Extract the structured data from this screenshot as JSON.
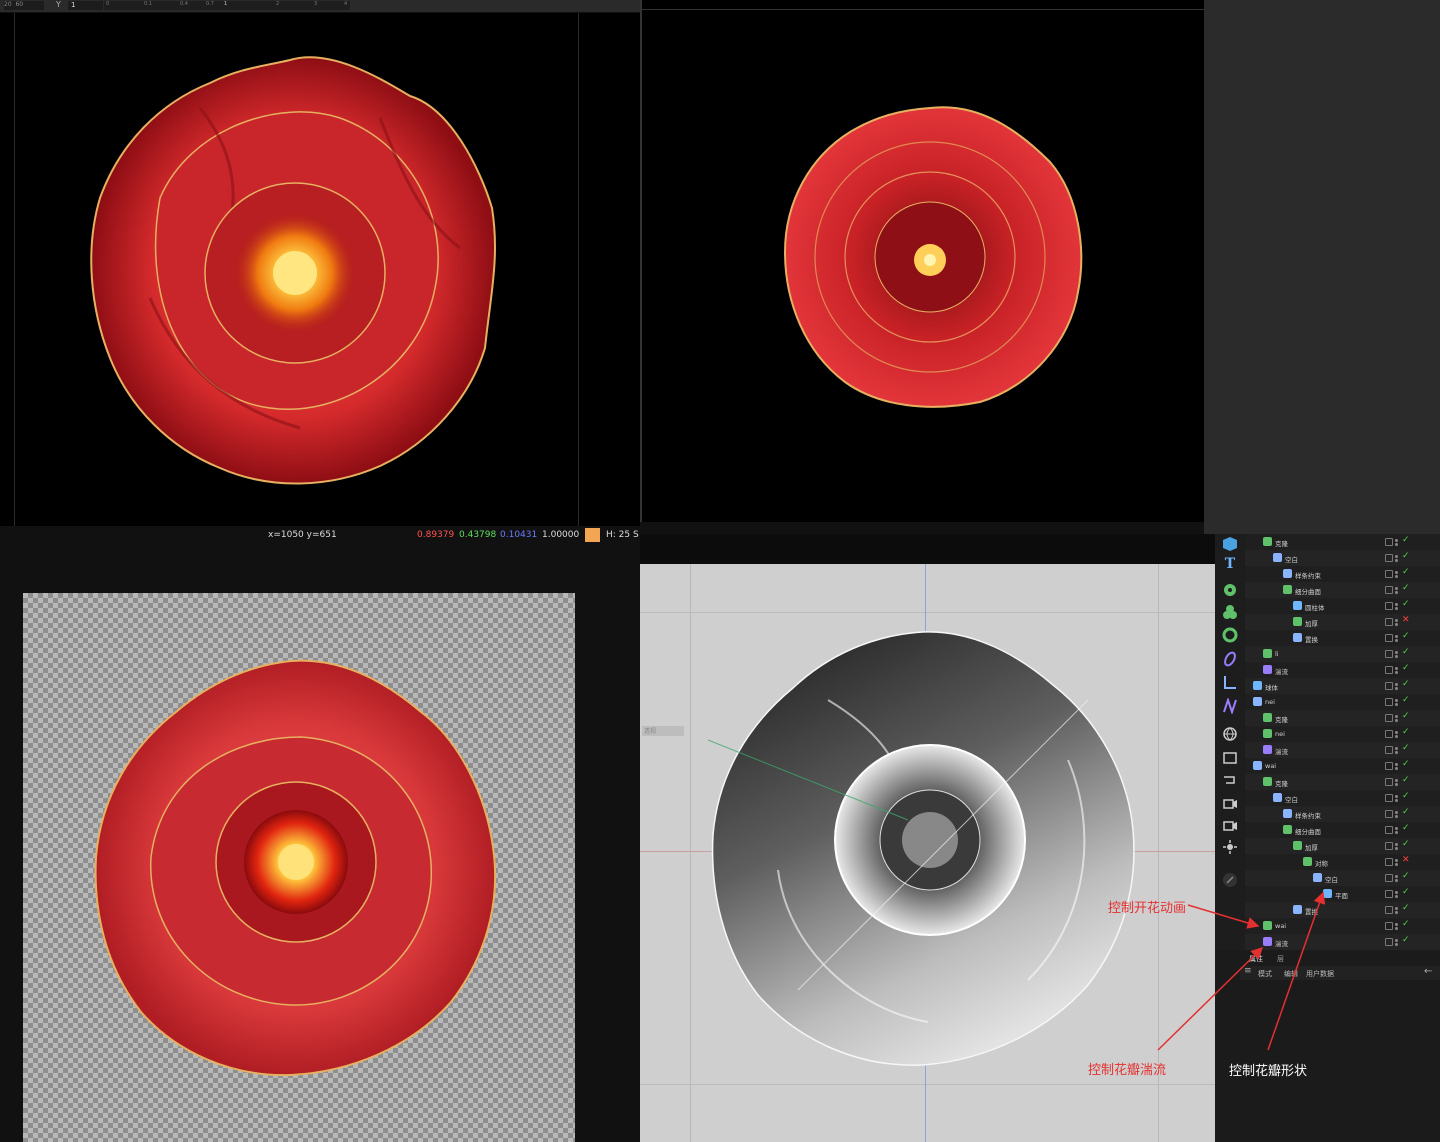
{
  "topbar": {
    "y_label": "Y",
    "y_value": "1",
    "ruler_ticks": [
      "0",
      "0.1",
      "0.4",
      "0.7",
      "1",
      "2",
      "3",
      "4"
    ]
  },
  "status": {
    "coords": "x=1050 y=651",
    "r": "0.89379",
    "g": "0.43798",
    "b": "0.10431",
    "a": "1.00000",
    "h": "H: 25 S",
    "swatch": "#f2a654"
  },
  "annotations": {
    "bloom_anim": "控制开花动画",
    "petal_turbulence": "控制花瓣湍流",
    "petal_shape": "控制花瓣形状"
  },
  "object_tree": [
    {
      "indent": 1,
      "label": "克隆",
      "icon": "cloner-icon",
      "color": "#5fc26a",
      "state": "ok"
    },
    {
      "indent": 2,
      "label": "空白",
      "icon": "null-icon",
      "color": "#8ab4ff",
      "state": "ok"
    },
    {
      "indent": 3,
      "label": "样条约束",
      "icon": "spline-wrap-icon",
      "color": "#8ab4ff",
      "state": "ok"
    },
    {
      "indent": 3,
      "label": "细分曲面",
      "icon": "subdivision-icon",
      "color": "#5fc26a",
      "state": "ok"
    },
    {
      "indent": 4,
      "label": "圆柱体",
      "icon": "cylinder-icon",
      "color": "#6fb6ff",
      "state": "ok"
    },
    {
      "indent": 4,
      "label": "加厚",
      "icon": "thicken-icon",
      "color": "#5fc26a",
      "state": "x"
    },
    {
      "indent": 4,
      "label": "置换",
      "icon": "displacer-icon",
      "color": "#8ab4ff",
      "state": "ok"
    },
    {
      "indent": 1,
      "label": "li",
      "icon": "emitter-icon",
      "color": "#5fc26a",
      "state": "ok"
    },
    {
      "indent": 1,
      "label": "湍流",
      "icon": "turbulence-icon",
      "color": "#9a7cff",
      "state": "ok"
    },
    {
      "indent": 0,
      "label": "球体",
      "icon": "sphere-icon",
      "color": "#6fb6ff",
      "state": "ok"
    },
    {
      "indent": 0,
      "label": "nei",
      "icon": "null-icon",
      "color": "#8ab4ff",
      "state": "ok"
    },
    {
      "indent": 1,
      "label": "克隆",
      "icon": "cloner-icon",
      "color": "#5fc26a",
      "state": "ok"
    },
    {
      "indent": 1,
      "label": "nei",
      "icon": "emitter-icon",
      "color": "#5fc26a",
      "state": "ok"
    },
    {
      "indent": 1,
      "label": "湍流",
      "icon": "turbulence-icon",
      "color": "#9a7cff",
      "state": "ok"
    },
    {
      "indent": 0,
      "label": "wai",
      "icon": "null-icon",
      "color": "#8ab4ff",
      "state": "ok"
    },
    {
      "indent": 1,
      "label": "克隆",
      "icon": "cloner-icon",
      "color": "#5fc26a",
      "state": "ok"
    },
    {
      "indent": 2,
      "label": "空白",
      "icon": "null-icon",
      "color": "#8ab4ff",
      "state": "ok"
    },
    {
      "indent": 3,
      "label": "样条约束",
      "icon": "spline-wrap-icon",
      "color": "#8ab4ff",
      "state": "ok"
    },
    {
      "indent": 3,
      "label": "细分曲面",
      "icon": "subdivision-icon",
      "color": "#5fc26a",
      "state": "ok"
    },
    {
      "indent": 4,
      "label": "加厚",
      "icon": "thicken-icon",
      "color": "#5fc26a",
      "state": "ok"
    },
    {
      "indent": 5,
      "label": "对称",
      "icon": "symmetry-icon",
      "color": "#5fc26a",
      "state": "x"
    },
    {
      "indent": 6,
      "label": "空白",
      "icon": "null-icon",
      "color": "#8ab4ff",
      "state": "ok"
    },
    {
      "indent": 7,
      "label": "平面",
      "icon": "plane-icon",
      "color": "#6fb6ff",
      "state": "ok"
    },
    {
      "indent": 4,
      "label": "置换",
      "icon": "displacer-icon",
      "color": "#8ab4ff",
      "state": "ok"
    },
    {
      "indent": 1,
      "label": "wai",
      "icon": "emitter-icon",
      "color": "#5fc26a",
      "state": "ok"
    },
    {
      "indent": 1,
      "label": "湍流",
      "icon": "turbulence-icon",
      "color": "#9a7cff",
      "state": "ok"
    }
  ],
  "bottom_tabs": {
    "tab_attributes": "属性",
    "tab_layers": "层",
    "mode": "模式",
    "edit": "编辑",
    "user_data": "用户数据"
  },
  "viewport_hint": "透视"
}
